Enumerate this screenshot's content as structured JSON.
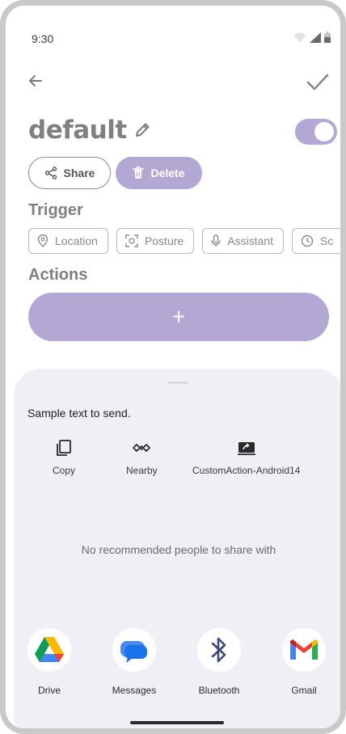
{
  "status_bar": {
    "time": "9:30"
  },
  "header": {
    "title": "default",
    "share_label": "Share",
    "delete_label": "Delete",
    "toggle_on": true
  },
  "trigger": {
    "label": "Trigger",
    "chips": [
      {
        "label": "Location",
        "icon": "location-pin-icon"
      },
      {
        "label": "Posture",
        "icon": "posture-icon"
      },
      {
        "label": "Assistant",
        "icon": "mic-icon"
      },
      {
        "label": "Sc",
        "icon": "clock-icon"
      }
    ]
  },
  "actions": {
    "label": "Actions",
    "add_symbol": "+"
  },
  "share_sheet": {
    "text": "Sample text to send.",
    "quick_actions": [
      {
        "label": "Copy",
        "icon": "copy-icon"
      },
      {
        "label": "Nearby",
        "icon": "nearby-share-icon"
      },
      {
        "label": "CustomAction-Android14",
        "icon": "custom-action-icon"
      }
    ],
    "no_people": "No recommended people to share with",
    "apps": [
      {
        "label": "Drive",
        "icon": "google-drive-icon"
      },
      {
        "label": "Messages",
        "icon": "messages-icon"
      },
      {
        "label": "Bluetooth",
        "icon": "bluetooth-icon"
      },
      {
        "label": "Gmail",
        "icon": "gmail-icon"
      }
    ]
  },
  "colors": {
    "accent": "#b3a7d4",
    "sheet_bg": "#f0eff5",
    "muted_text": "#808080"
  }
}
